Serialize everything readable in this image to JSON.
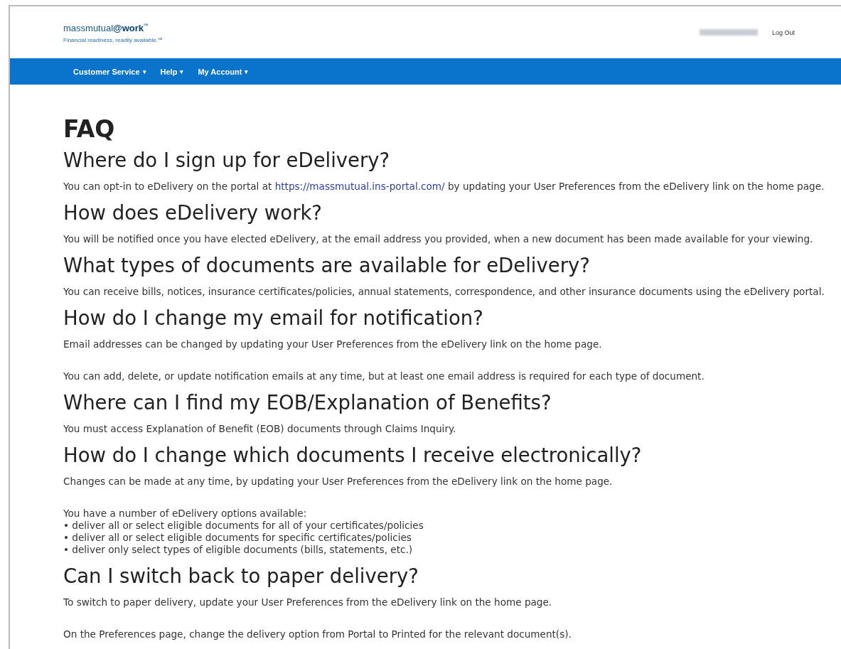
{
  "header": {
    "logo": {
      "brand": "massmutual",
      "brand_bold": "@work",
      "brand_mark": "℠",
      "tagline": "Financial readiness, readily available.℠"
    },
    "user_name_redacted": true,
    "logout": "Log Out"
  },
  "nav": [
    {
      "label": "Customer Service",
      "caret": "▾"
    },
    {
      "label": "Help",
      "caret": "▾"
    },
    {
      "label": "My Account",
      "caret": "▾"
    }
  ],
  "page_title": "FAQ",
  "faqs": [
    {
      "question": "Where do I sign up for eDelivery?",
      "answer": [
        {
          "kind": "link_text",
          "before": "You can opt-in to eDelivery on the portal at ",
          "link": "https://massmutual.ins-portal.com/",
          "after": " by updating your User Preferences from the eDelivery link on the home page."
        }
      ]
    },
    {
      "question": "How does eDelivery work?",
      "answer": [
        {
          "kind": "text",
          "text": "You will be notified once you have elected eDelivery, at the email address you provided, when a new document has been made available for your viewing."
        }
      ]
    },
    {
      "question": "What types of documents are available for eDelivery?",
      "answer": [
        {
          "kind": "text",
          "text": "You can receive bills, notices, insurance certificates/policies, annual statements, correspondence, and other insurance documents using the eDelivery portal."
        }
      ]
    },
    {
      "question": "How do I change my email for notification?",
      "answer": [
        {
          "kind": "text",
          "text": "Email addresses can be changed by updating your User Preferences from the eDelivery link on the home page."
        },
        {
          "kind": "text",
          "text": "You can add, delete, or update notification emails at any time, but at least one email address is required for each type of document."
        }
      ]
    },
    {
      "question": "Where can I find my EOB/Explanation of Benefits?",
      "answer": [
        {
          "kind": "text",
          "text": "You must access Explanation of Benefit (EOB) documents through Claims Inquiry."
        }
      ]
    },
    {
      "question": "How do I change which documents I receive electronically?",
      "answer": [
        {
          "kind": "text",
          "text": "Changes can be made at any time, by updating your User Preferences from the eDelivery link on the home page."
        },
        {
          "kind": "lines",
          "lines": [
            "You have a number of eDelivery options available:",
            "• deliver all or select eligible documents for all of your certificates/policies",
            "• deliver all or select eligible documents for specific certificates/policies",
            "• deliver only select types of eligible documents (bills, statements, etc.)"
          ]
        }
      ]
    },
    {
      "question": "Can I switch back to paper delivery?",
      "answer": [
        {
          "kind": "text",
          "text": "To switch to paper delivery, update your User Preferences from the eDelivery link on the home page."
        },
        {
          "kind": "text",
          "text": "On the Preferences page, change the delivery option from Portal to Printed for the relevant document(s)."
        }
      ]
    }
  ]
}
